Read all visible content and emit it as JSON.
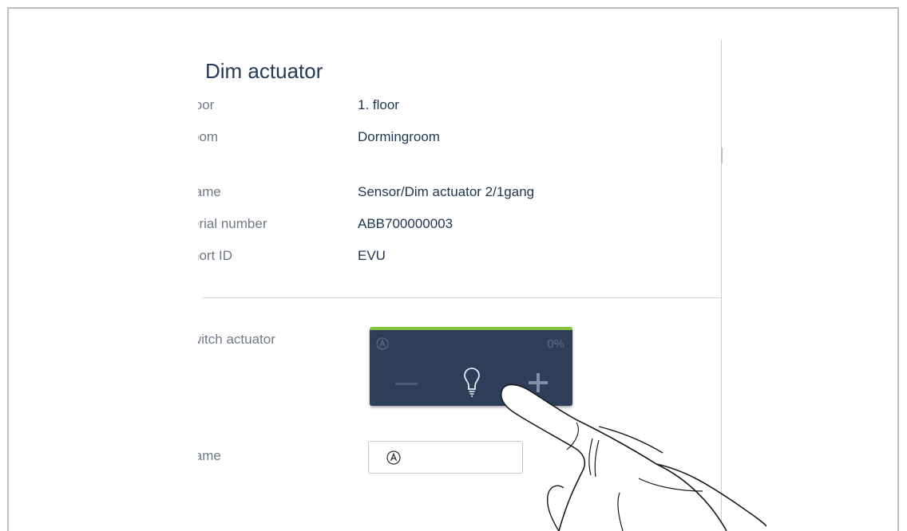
{
  "title": "Dim actuator",
  "location": {
    "floor_label": "loor",
    "floor_value": "1. floor",
    "room_label": "oom",
    "room_value": "Dormingroom"
  },
  "device": {
    "name_label": "lame",
    "name_value": "Sensor/Dim actuator 2/1gang",
    "serial_label": "erial number",
    "serial_value": "ABB700000003",
    "shortid_label": "hort ID",
    "shortid_value": "EVU"
  },
  "switch": {
    "label": "witch actuator",
    "percent": "0%",
    "accent": "#86c440",
    "tile_color": "#2c3e58",
    "icons": [
      "auto-icon",
      "minus-icon",
      "bulb-icon",
      "plus-icon"
    ]
  },
  "name_field": {
    "label": "lame",
    "icon": "auto-icon"
  }
}
